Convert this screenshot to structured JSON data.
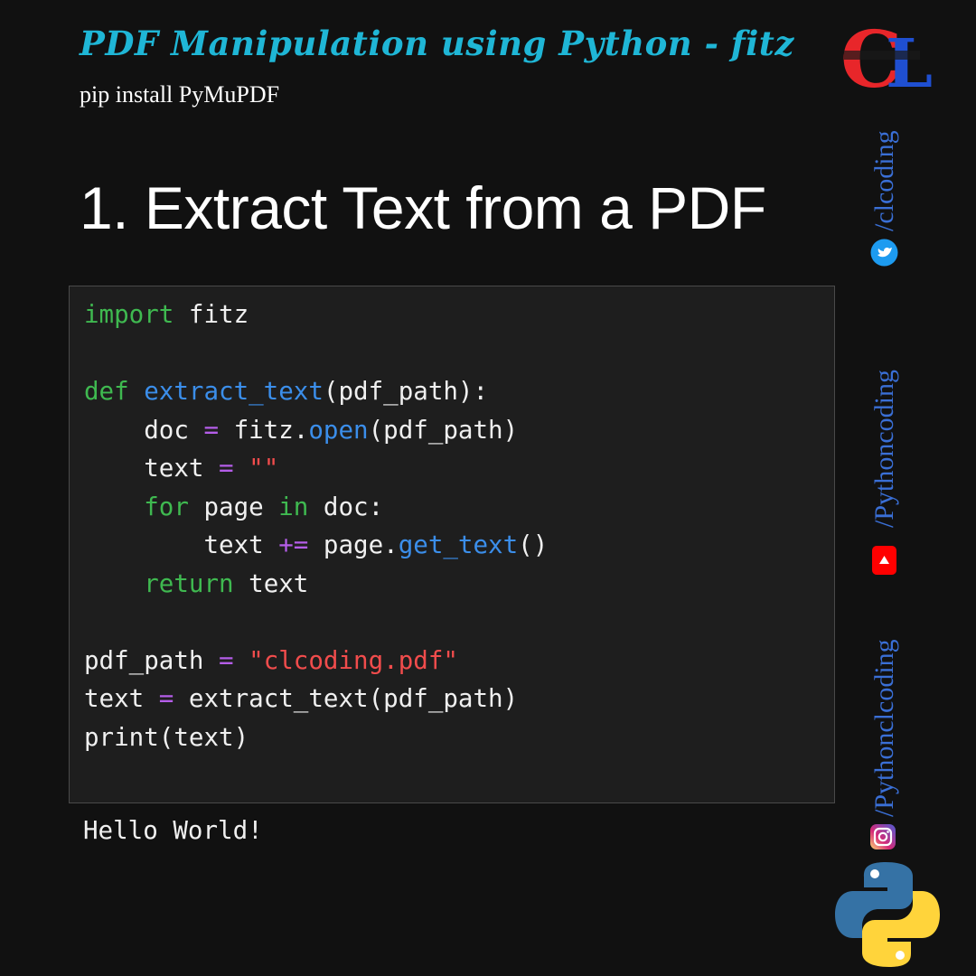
{
  "header": {
    "title": "PDF Manipulation using Python - fitz",
    "install": "pip install PyMuPDF"
  },
  "section": {
    "heading": "1. Extract Text from a PDF"
  },
  "code": {
    "lines": [
      [
        {
          "t": "import",
          "c": "kw"
        },
        {
          "t": " fitz"
        }
      ],
      [],
      [
        {
          "t": "def",
          "c": "kw"
        },
        {
          "t": " "
        },
        {
          "t": "extract_text",
          "c": "fn"
        },
        {
          "t": "(pdf_path):"
        }
      ],
      [
        {
          "t": "    doc "
        },
        {
          "t": "=",
          "c": "op"
        },
        {
          "t": " fitz."
        },
        {
          "t": "open",
          "c": "fn"
        },
        {
          "t": "(pdf_path)"
        }
      ],
      [
        {
          "t": "    text "
        },
        {
          "t": "=",
          "c": "op"
        },
        {
          "t": " "
        },
        {
          "t": "\"\"",
          "c": "st"
        }
      ],
      [
        {
          "t": "    "
        },
        {
          "t": "for",
          "c": "kw"
        },
        {
          "t": " page "
        },
        {
          "t": "in",
          "c": "kw"
        },
        {
          "t": " doc:"
        }
      ],
      [
        {
          "t": "        text "
        },
        {
          "t": "+=",
          "c": "op"
        },
        {
          "t": " page."
        },
        {
          "t": "get_text",
          "c": "fn"
        },
        {
          "t": "()"
        }
      ],
      [
        {
          "t": "    "
        },
        {
          "t": "return",
          "c": "kw"
        },
        {
          "t": " text"
        }
      ],
      [],
      [
        {
          "t": "pdf_path "
        },
        {
          "t": "=",
          "c": "op"
        },
        {
          "t": " "
        },
        {
          "t": "\"clcoding.pdf\"",
          "c": "st"
        }
      ],
      [
        {
          "t": "text "
        },
        {
          "t": "=",
          "c": "op"
        },
        {
          "t": " extract_text(pdf_path)"
        }
      ],
      [
        {
          "t": "print(text)"
        }
      ]
    ]
  },
  "output": {
    "text": "Hello World!"
  },
  "sidebar": {
    "logo_letters": "CL",
    "handles": [
      {
        "label": "/clcoding",
        "icon": "twitter-icon"
      },
      {
        "label": "/Pythoncoding",
        "icon": "youtube-icon"
      },
      {
        "label": "/Pythonclcoding",
        "icon": "instagram-icon"
      }
    ],
    "python_logo": "python-logo"
  },
  "colors": {
    "background": "#111111",
    "title": "#1fb6d6",
    "keyword": "#3fb950",
    "function": "#3b8eea",
    "operator": "#b45de8",
    "string": "#f14c4c",
    "handle": "#3a6fd6"
  }
}
